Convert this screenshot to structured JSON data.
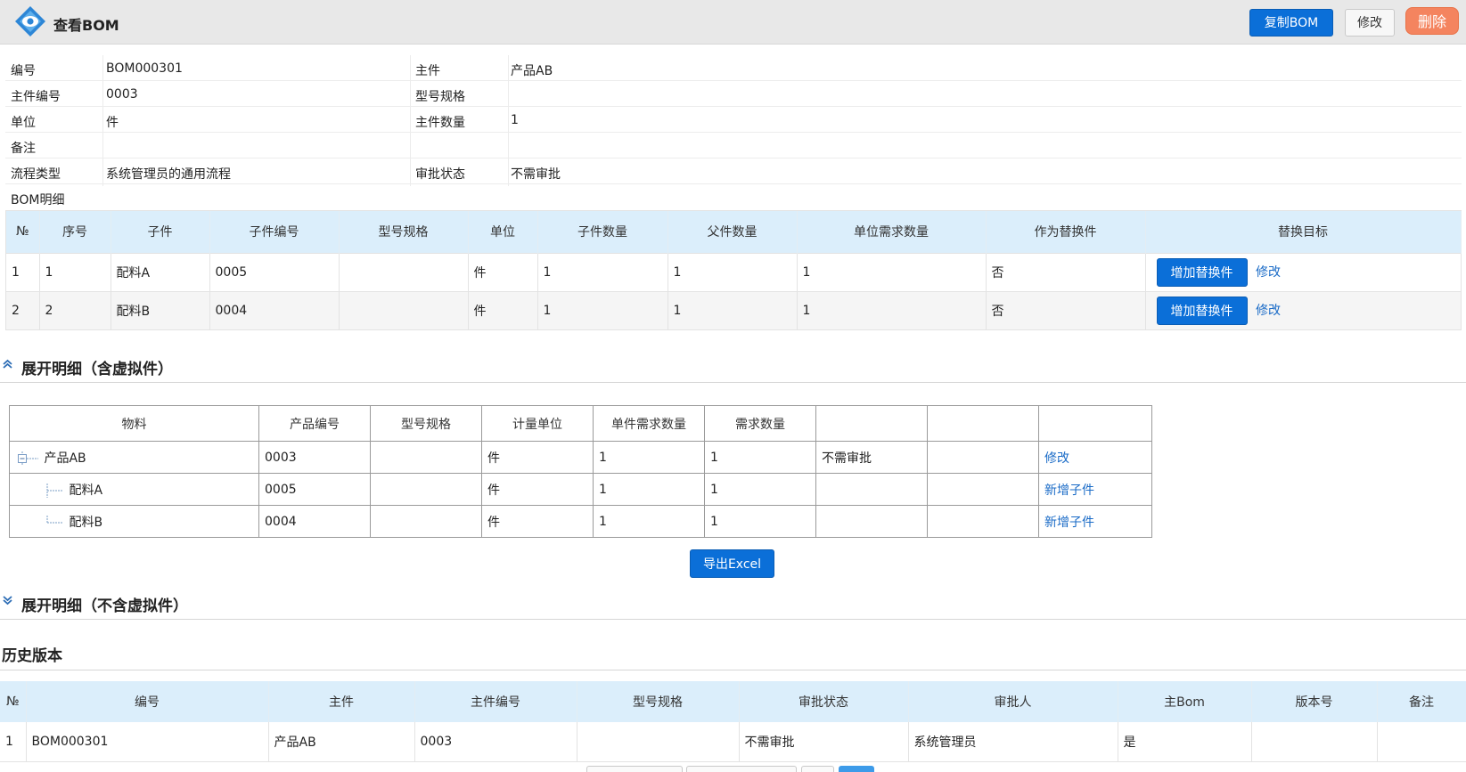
{
  "header": {
    "title": "查看BOM",
    "copy_label": "复制BOM",
    "edit_label": "修改",
    "delete_label": "删除"
  },
  "info": {
    "code_label": "编号",
    "code_value": "BOM000301",
    "main_label": "主件",
    "main_value": "产品AB",
    "main_code_label": "主件编号",
    "main_code_value": "0003",
    "spec_label": "型号规格",
    "spec_value": "",
    "unit_label": "单位",
    "unit_value": "件",
    "main_qty_label": "主件数量",
    "main_qty_value": "1",
    "remark_label": "备注",
    "remark_value": "",
    "flow_label": "流程类型",
    "flow_value": "系统管理员的通用流程",
    "approval_label": "审批状态",
    "approval_value": "不需审批",
    "detail_label": "BOM明细"
  },
  "detail": {
    "headers": [
      "№",
      "序号",
      "子件",
      "子件编号",
      "型号规格",
      "单位",
      "子件数量",
      "父件数量",
      "单位需求数量",
      "作为替换件",
      "替换目标"
    ],
    "rows": [
      {
        "no": "1",
        "seq": "1",
        "part": "配料A",
        "code": "0005",
        "spec": "",
        "unit": "件",
        "qty": "1",
        "parent_qty": "1",
        "unit_need": "1",
        "is_sub": "否",
        "action": "增加替换件",
        "edit": "修改"
      },
      {
        "no": "2",
        "seq": "2",
        "part": "配料B",
        "code": "0004",
        "spec": "",
        "unit": "件",
        "qty": "1",
        "parent_qty": "1",
        "unit_need": "1",
        "is_sub": "否",
        "action": "增加替换件",
        "edit": "修改"
      }
    ]
  },
  "expand_with_virtual": {
    "title": "展开明细（含虚拟件）",
    "headers": [
      "物料",
      "产品编号",
      "型号规格",
      "计量单位",
      "单件需求数量",
      "需求数量",
      "",
      "",
      ""
    ],
    "rows": [
      {
        "name": "产品AB",
        "code": "0003",
        "spec": "",
        "unit": "件",
        "unit_need": "1",
        "need": "1",
        "status": "不需审批",
        "extra": "",
        "action": "修改"
      },
      {
        "name": "配料A",
        "code": "0005",
        "spec": "",
        "unit": "件",
        "unit_need": "1",
        "need": "1",
        "status": "",
        "extra": "",
        "action": "新增子件"
      },
      {
        "name": "配料B",
        "code": "0004",
        "spec": "",
        "unit": "件",
        "unit_need": "1",
        "need": "1",
        "status": "",
        "extra": "",
        "action": "新增子件"
      }
    ],
    "export_label": "导出Excel"
  },
  "expand_without_virtual": {
    "title": "展开明细（不含虚拟件）"
  },
  "history": {
    "title": "历史版本",
    "headers": [
      "№",
      "编号",
      "主件",
      "主件编号",
      "型号规格",
      "审批状态",
      "审批人",
      "主Bom",
      "版本号",
      "备注"
    ],
    "rows": [
      {
        "no": "1",
        "code": "BOM000301",
        "main": "产品AB",
        "main_code": "0003",
        "spec": "",
        "status": "不需审批",
        "approver": "系统管理员",
        "is_main": "是",
        "version": "",
        "remark": ""
      }
    ]
  },
  "colors": {
    "accent": "#0b6fd8",
    "delete": "#f4845f",
    "header_bg": "#e8e8e8",
    "table_head_bg": "#dbeefb",
    "link": "#1a6bc7"
  }
}
